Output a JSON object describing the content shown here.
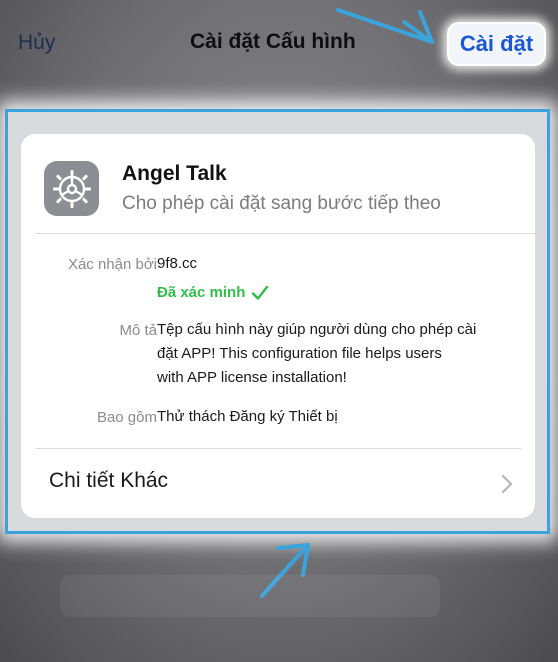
{
  "nav": {
    "cancel_label": "Hủy",
    "title": "Cài đặt Cấu hình",
    "install_label": "Cài đặt"
  },
  "profile": {
    "icon": "settings-gear-icon",
    "name": "Angel Talk",
    "subtitle": "Cho phép cài đặt sang bước tiếp theo"
  },
  "details": {
    "signed_by_label": "Xác nhận bởi",
    "signed_by_value": "9f8.cc",
    "verified_label": "Đã xác minh",
    "verified_icon": "checkmark-icon",
    "description_label": "Mô tả",
    "description_lines": [
      "Tệp cấu hình này giúp người dùng cho phép cài",
      "đặt APP!   This configuration file helps users",
      "with APP license installation!"
    ],
    "contains_label": "Bao gồm",
    "contains_value": "Thử thách Đăng ký Thiết bị"
  },
  "more_details": {
    "label": "Chi tiết Khác",
    "icon": "chevron-right-icon"
  },
  "colors": {
    "accent": "#1a58d6",
    "verified": "#2fbf4a",
    "annotation": "#3ba3dc"
  }
}
